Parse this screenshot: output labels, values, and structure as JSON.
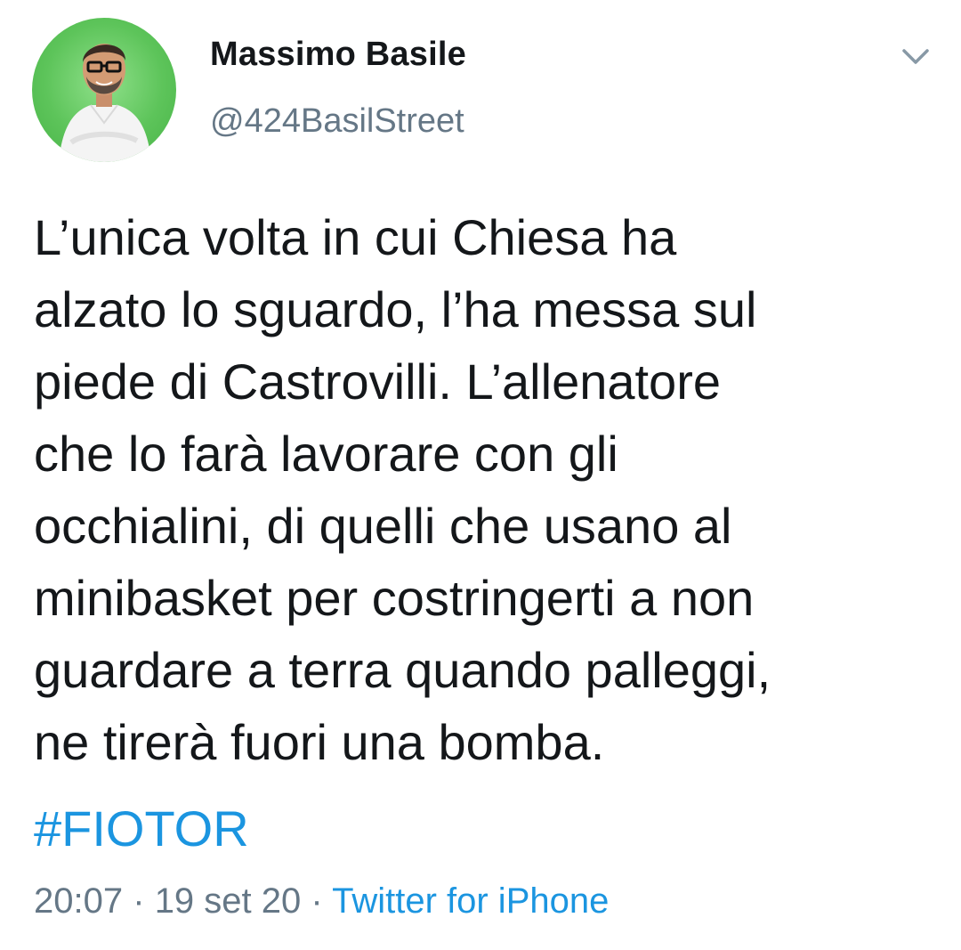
{
  "author": {
    "display_name": "Massimo Basile",
    "handle": "@424BasilStreet",
    "avatar_icon": "profile-photo"
  },
  "tweet": {
    "lines": [
      "L’unica volta in cui Chiesa ha",
      "alzato lo sguardo, l’ha messa sul",
      "piede di Castrovilli. L’allenatore",
      "che lo farà lavorare con gli",
      "occhialini, di quelli che usano al",
      "minibasket per costringerti a non",
      "guardare a terra quando palleggi,",
      "ne tirerà fuori una bomba."
    ],
    "hashtag": "#FIOTOR"
  },
  "meta": {
    "time": "20:07",
    "separator1": "·",
    "date": "19 set 20",
    "separator2": "·",
    "source": "Twitter for iPhone"
  },
  "icons": {
    "menu": "chevron-down-icon"
  },
  "colors": {
    "text": "#14171a",
    "secondary": "#657786",
    "link": "#1b95e0",
    "avatar_bg": "#5dc45a"
  }
}
